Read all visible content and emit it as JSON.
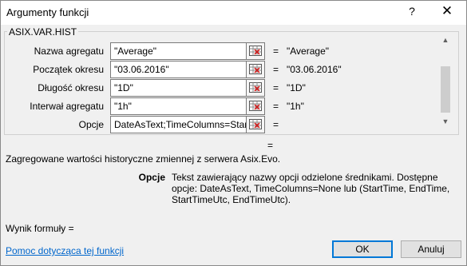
{
  "window": {
    "title": "Argumenty funkcji",
    "help_glyph": "?",
    "close_glyph": "✕"
  },
  "function_group": {
    "title": "ASIX.VAR.HIST",
    "args": [
      {
        "label": "Nazwa agregatu",
        "value": "\"Average\"",
        "eq": "=",
        "result": "\"Average\""
      },
      {
        "label": "Początek okresu",
        "value": "\"03.06.2016\"",
        "eq": "=",
        "result": "\"03.06.2016\""
      },
      {
        "label": "Długość okresu",
        "value": "\"1D\"",
        "eq": "=",
        "result": "\"1D\""
      },
      {
        "label": "Interwał agregatu",
        "value": "\"1h\"",
        "eq": "=",
        "result": "\"1h\""
      },
      {
        "label": "Opcje",
        "value": "DateAsText;TimeColumns=Start",
        "eq": "=",
        "result": ""
      }
    ]
  },
  "formula_eq": "=",
  "description": "Zagregowane wartości historyczne zmiennej z serwera Asix.Evo.",
  "arg_help": {
    "name": "Opcje",
    "text": "Tekst zawierający nazwy opcji odzielone średnikami. Dostępne opcje: DateAsText, TimeColumns=None lub (StartTime, EndTime, StartTimeUtc, EndTimeUtc)."
  },
  "result_label": "Wynik formuły =",
  "help_link": "Pomoc dotycząca tej funkcji",
  "buttons": {
    "ok": "OK",
    "cancel": "Anuluj"
  },
  "icons": {
    "collapse": "range-select-icon",
    "scroll_up": "chevron-up-icon",
    "scroll_down": "chevron-down-icon"
  }
}
